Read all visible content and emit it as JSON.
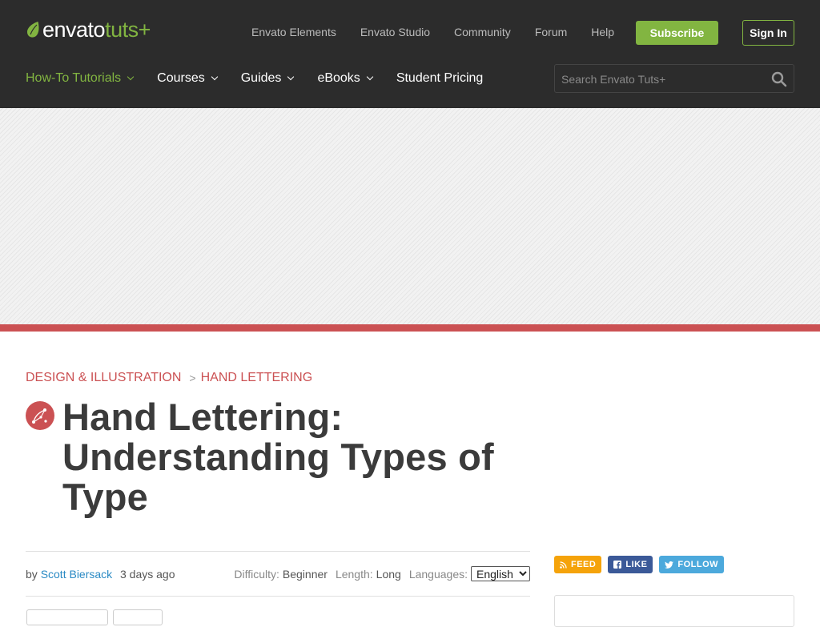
{
  "header": {
    "logo_part1": "envato",
    "logo_part2": "tuts+",
    "topnav": [
      "Envato Elements",
      "Envato Studio",
      "Community",
      "Forum",
      "Help"
    ],
    "subscribe_label": "Subscribe",
    "signin_label": "Sign In",
    "mainnav": [
      {
        "label": "How-To Tutorials",
        "dropdown": true,
        "active": true
      },
      {
        "label": "Courses",
        "dropdown": true,
        "active": false
      },
      {
        "label": "Guides",
        "dropdown": true,
        "active": false
      },
      {
        "label": "eBooks",
        "dropdown": true,
        "active": false
      },
      {
        "label": "Student Pricing",
        "dropdown": false,
        "active": false
      }
    ],
    "search_placeholder": "Search Envato Tuts+"
  },
  "article": {
    "breadcrumb": [
      "DESIGN & ILLUSTRATION",
      "HAND LETTERING"
    ],
    "breadcrumb_sep": ">",
    "category_icon": "vector-pen-icon",
    "title": "Hand Lettering: Understanding Types of Type",
    "meta": {
      "by_label": "by",
      "author": "Scott Biersack",
      "date": "3 days ago",
      "difficulty_label": "Difficulty:",
      "difficulty_value": "Beginner",
      "length_label": "Length:",
      "length_value": "Long",
      "languages_label": "Languages:",
      "language_selected": "English"
    }
  },
  "social": {
    "feed_label": "FEED",
    "like_label": "LIKE",
    "follow_label": "FOLLOW"
  },
  "colors": {
    "header_bg": "#2c2c2c",
    "brand_green": "#82b541",
    "accent_red": "#cb5153",
    "link_blue": "#2a8ac4",
    "feed": "#f5a30a",
    "facebook": "#3b5998",
    "twitter": "#4ca9dc"
  }
}
